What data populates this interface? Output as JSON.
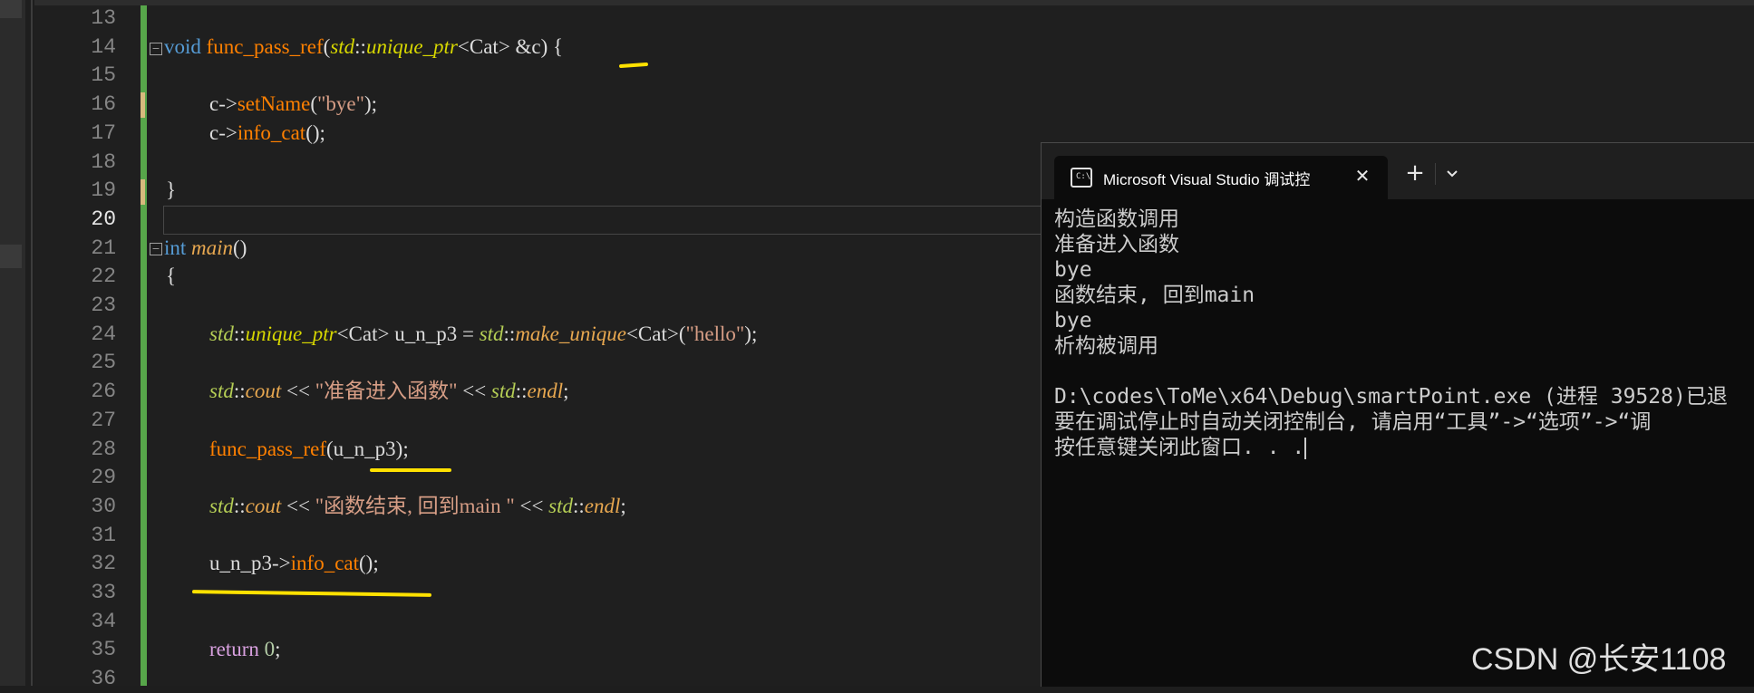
{
  "editor": {
    "lines": [
      {
        "num": "13",
        "parts": []
      },
      {
        "num": "14",
        "parts": [
          [
            "kw",
            "void"
          ],
          [
            "tp",
            " "
          ],
          [
            "fn2",
            "func_pass_ref"
          ],
          [
            "tp",
            "("
          ],
          [
            "ns",
            "std"
          ],
          [
            "tp",
            "::"
          ],
          [
            "ns",
            "unique_ptr"
          ],
          [
            "tp",
            "<Cat> &c) {"
          ]
        ]
      },
      {
        "num": "15",
        "parts": []
      },
      {
        "num": "16",
        "parts": [
          [
            "tp",
            "c->"
          ],
          [
            "fn2",
            "setName"
          ],
          [
            "tp",
            "("
          ],
          [
            "str",
            "\"bye\""
          ],
          [
            "tp",
            ");"
          ]
        ]
      },
      {
        "num": "17",
        "parts": [
          [
            "tp",
            "c->"
          ],
          [
            "fn2",
            "info_cat"
          ],
          [
            "tp",
            "();"
          ]
        ]
      },
      {
        "num": "18",
        "parts": []
      },
      {
        "num": "19",
        "parts": [
          [
            "tp",
            "}"
          ]
        ]
      },
      {
        "num": "20",
        "parts": []
      },
      {
        "num": "21",
        "parts": [
          [
            "kw",
            "int"
          ],
          [
            "tp",
            " "
          ],
          [
            "mac",
            "main"
          ],
          [
            "tp",
            "()"
          ]
        ]
      },
      {
        "num": "22",
        "parts": [
          [
            "tp",
            "{"
          ]
        ]
      },
      {
        "num": "23",
        "parts": []
      },
      {
        "num": "24",
        "parts": [
          [
            "nsi",
            "std"
          ],
          [
            "tp",
            "::"
          ],
          [
            "ns",
            "unique_ptr"
          ],
          [
            "tp",
            "<Cat> u_n_p3 = "
          ],
          [
            "nsi",
            "std"
          ],
          [
            "tp",
            "::"
          ],
          [
            "mac",
            "make_unique"
          ],
          [
            "tp",
            "<Cat>("
          ],
          [
            "str",
            "\"hello\""
          ],
          [
            "tp",
            ");"
          ]
        ]
      },
      {
        "num": "25",
        "parts": []
      },
      {
        "num": "26",
        "parts": [
          [
            "nsi",
            "std"
          ],
          [
            "tp",
            "::"
          ],
          [
            "mac",
            "cout"
          ],
          [
            "tp",
            " << "
          ],
          [
            "str",
            "\"准备进入函数\""
          ],
          [
            "tp",
            " << "
          ],
          [
            "nsi",
            "std"
          ],
          [
            "tp",
            "::"
          ],
          [
            "mac",
            "endl"
          ],
          [
            "tp",
            ";"
          ]
        ]
      },
      {
        "num": "27",
        "parts": []
      },
      {
        "num": "28",
        "parts": [
          [
            "fn2",
            "func_pass_ref"
          ],
          [
            "tp",
            "(u_n_p3);"
          ]
        ]
      },
      {
        "num": "29",
        "parts": []
      },
      {
        "num": "30",
        "parts": [
          [
            "nsi",
            "std"
          ],
          [
            "tp",
            "::"
          ],
          [
            "mac",
            "cout"
          ],
          [
            "tp",
            " << "
          ],
          [
            "str",
            "\"函数结束, 回到main \""
          ],
          [
            "tp",
            " << "
          ],
          [
            "nsi",
            "std"
          ],
          [
            "tp",
            "::"
          ],
          [
            "mac",
            "endl"
          ],
          [
            "tp",
            ";"
          ]
        ]
      },
      {
        "num": "31",
        "parts": []
      },
      {
        "num": "32",
        "parts": [
          [
            "tp",
            "u_n_p3->"
          ],
          [
            "fn2",
            "info_cat"
          ],
          [
            "tp",
            "();"
          ]
        ]
      },
      {
        "num": "33",
        "parts": []
      },
      {
        "num": "34",
        "parts": []
      },
      {
        "num": "35",
        "parts": [
          [
            "kw2",
            "return"
          ],
          [
            "tp",
            " "
          ],
          [
            "num",
            "0"
          ],
          [
            "tp",
            ";"
          ]
        ]
      },
      {
        "num": "36",
        "parts": []
      }
    ]
  },
  "console": {
    "tab_title": "Microsoft Visual Studio 调试控",
    "tab_icon": "console-icon",
    "close_glyph": "✕",
    "new_tab_glyph": "+",
    "dropdown_icon": "chevron-down-icon",
    "output": [
      "构造函数调用",
      "准备进入函数",
      "bye",
      "函数结束, 回到main",
      "bye",
      "析构被调用",
      "",
      "D:\\codes\\ToMe\\x64\\Debug\\smartPoint.exe (进程 39528)已退",
      "要在调试停止时自动关闭控制台, 请启用“工具”->“选项”->“调",
      "按任意键关闭此窗口. . ."
    ]
  },
  "watermark": "CSDN @长安1108",
  "colors": {
    "change_bar": "#57a64a",
    "highlight": "#ffe100"
  }
}
